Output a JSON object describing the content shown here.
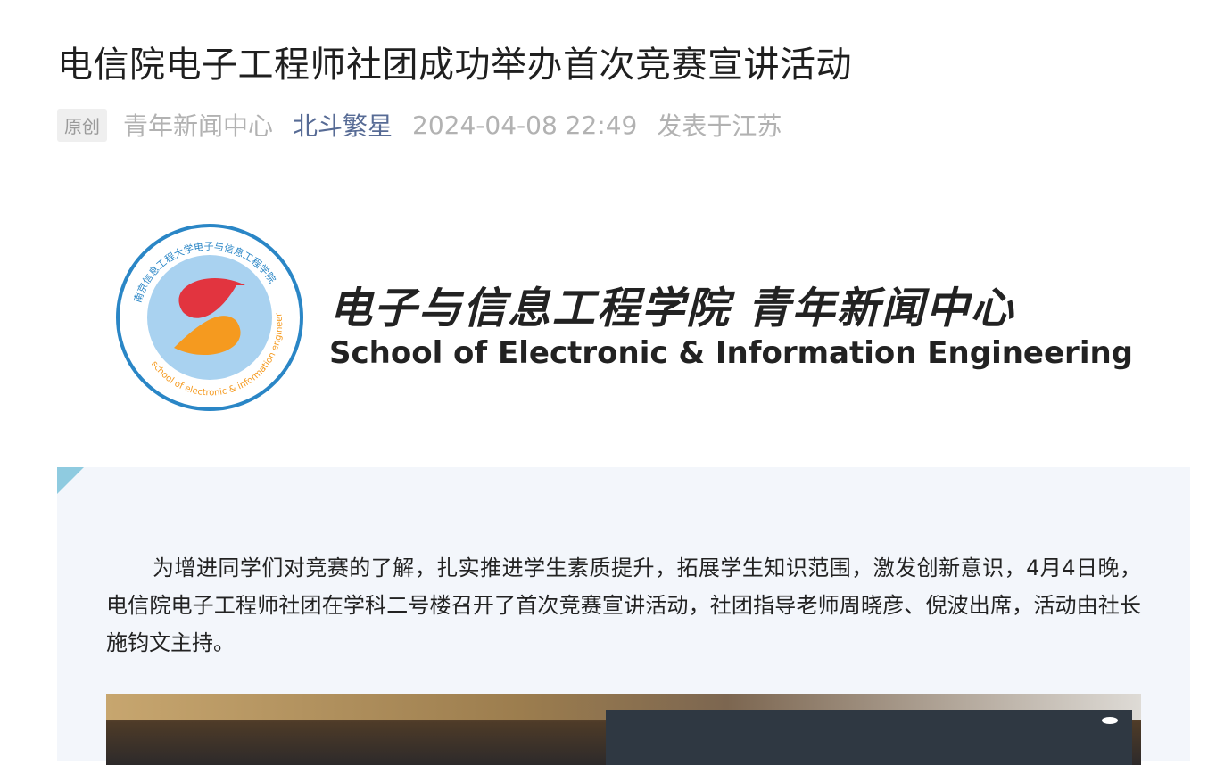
{
  "article": {
    "title": "电信院电子工程师社团成功举办首次竞赛宣讲活动",
    "badge": "原创",
    "source": "青年新闻中心",
    "author": "北斗繁星",
    "date": "2024-04-08 22:49",
    "location": "发表于江苏"
  },
  "banner": {
    "cn": "电子与信息工程学院 青年新闻中心",
    "en": "School of Electronic & Information Engineering",
    "seal_top": "南京信息工程大学电子与信息工程学院",
    "seal_bottom": "school of electronic & information engineering"
  },
  "body": {
    "paragraph": "为增进同学们对竞赛的了解，扎实推进学生素质提升，拓展学生知识范围，激发创新意识，4月4日晚，电信院电子工程师社团在学科二号楼召开了首次竞赛宣讲活动，社团指导老师周晓彦、倪波出席，活动由社长施钧文主持。"
  },
  "colors": {
    "author_link": "#576b95",
    "meta_gray": "#b2b2b2",
    "card_bg": "#f3f6fb",
    "card_corner": "#8fcbe0",
    "seal_blue": "#2a86c6",
    "seal_inner": "#a9d2f0",
    "seal_red": "#e2343f",
    "seal_orange": "#f59a1f"
  }
}
